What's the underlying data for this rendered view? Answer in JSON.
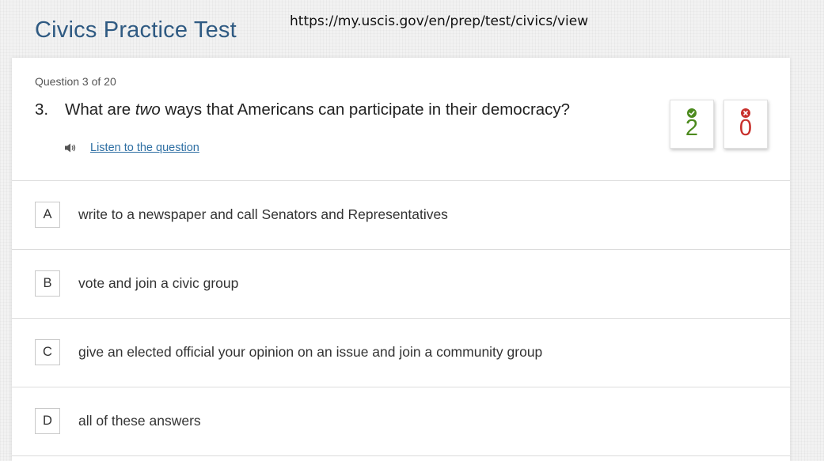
{
  "header": {
    "title": "Civics Practice Test",
    "url": "https://my.uscis.gov/en/prep/test/civics/view"
  },
  "question": {
    "progress": "Question 3 of 20",
    "number": "3.",
    "text_before": "What are ",
    "text_emphasis": "two",
    "text_after": " ways that Americans can participate in their democracy?",
    "listen_label": "Listen to the question",
    "speaker_icon": "speaker-icon"
  },
  "score": {
    "correct": "2",
    "incorrect": "0",
    "correct_icon": "check-circle-icon",
    "incorrect_icon": "x-circle-icon"
  },
  "answers": [
    {
      "letter": "A",
      "text": "write to a newspaper and call Senators and Representatives"
    },
    {
      "letter": "B",
      "text": "vote and join a civic group"
    },
    {
      "letter": "C",
      "text": "give an elected official your opinion on an issue and join a community group"
    },
    {
      "letter": "D",
      "text": "all of these answers"
    }
  ],
  "colors": {
    "title": "#2f5a82",
    "link": "#2e6fa3",
    "correct": "#4c8a1e",
    "incorrect": "#c8302c"
  }
}
